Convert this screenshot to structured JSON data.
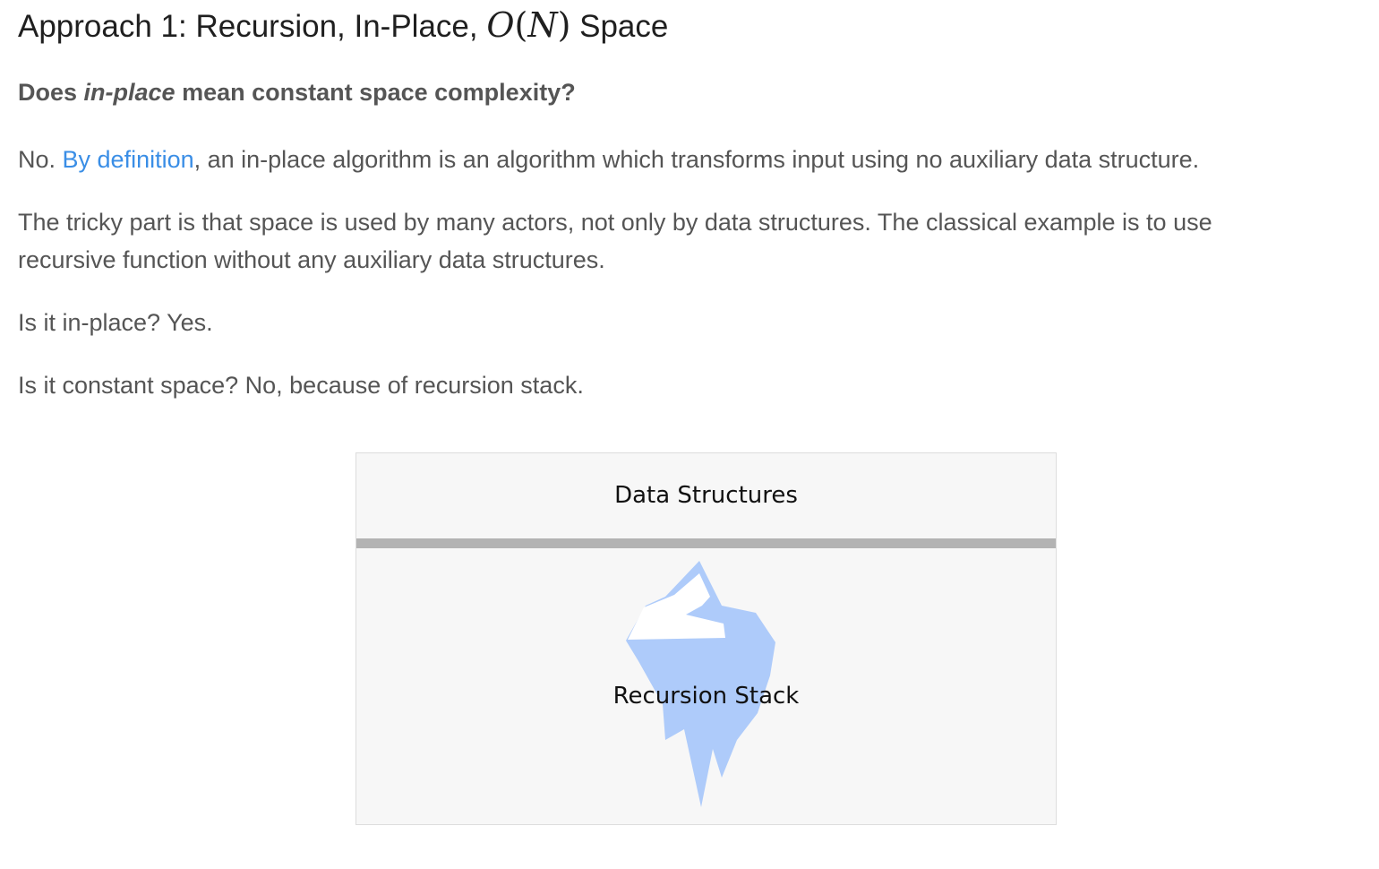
{
  "heading": {
    "prefix": "Approach 1: Recursion, In-Place, ",
    "math_O": "O",
    "math_lparen": "(",
    "math_N": "N",
    "math_rparen": ")",
    "suffix": " Space"
  },
  "question": {
    "before": "Does ",
    "emph": "in-place",
    "after": " mean constant space complexity?"
  },
  "para1": {
    "before": "No. ",
    "link": "By definition",
    "after": ", an in-place algorithm is an algorithm which transforms input using no auxiliary data structure."
  },
  "para2": {
    "line1": "The tricky part is that space is used by many actors, not only by data structures. The classical example is to use",
    "line2": "recursive function without any auxiliary data structures."
  },
  "para3": "Is it in-place? Yes.",
  "para4": "Is it constant space? No, because of recursion stack.",
  "figure": {
    "top_label": "Data Structures",
    "bottom_label": "Recursion Stack",
    "colors": {
      "background": "#f7f7f7",
      "waterline": "#b3b3b3",
      "iceberg": "#aecbfa",
      "ice_tip": "#ffffff"
    }
  }
}
